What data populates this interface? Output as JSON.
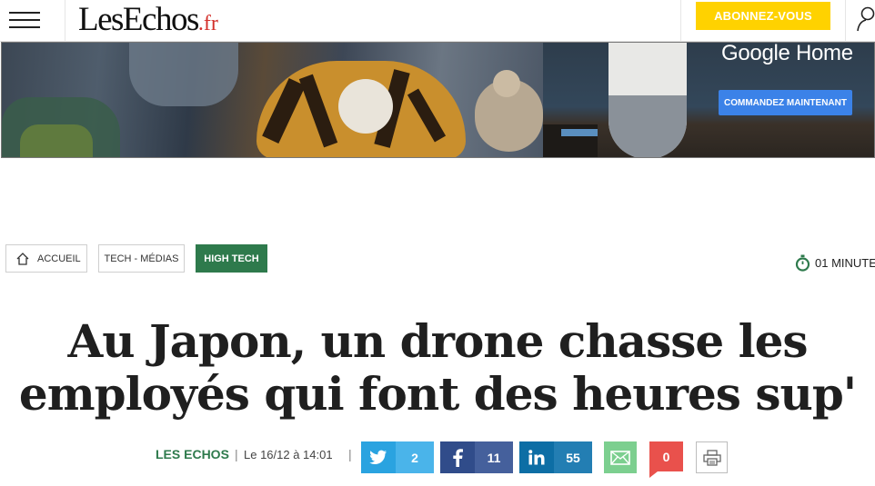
{
  "header": {
    "logo_main": "LesEchos",
    "logo_tld": ".fr",
    "subscribe_label": "ABONNEZ-VOUS"
  },
  "ad": {
    "title": "Google Home",
    "cta_label": "COMMANDEZ MAINTENANT"
  },
  "breadcrumb": {
    "items": [
      {
        "label": "ACCUEIL"
      },
      {
        "label": "TECH - MÉDIAS"
      },
      {
        "label": "HIGH TECH"
      }
    ]
  },
  "reading_time": "01 MINUTE",
  "article": {
    "headline_line1": "Au Japon, un drone chasse les",
    "headline_line2": "employés qui font des heures sup'",
    "source": "LES ECHOS",
    "date": "Le 16/12 à 14:01",
    "separator": "|"
  },
  "share": {
    "twitter_count": "2",
    "facebook_count": "11",
    "linkedin_count": "55",
    "comments_count": "0"
  },
  "colors": {
    "accent_green": "#2e7a4c",
    "subscribe_yellow": "#ffd200",
    "logo_red": "#d3302b",
    "twitter": "#2aa3e0",
    "facebook": "#304c8a",
    "linkedin": "#0d6ea5",
    "mail": "#7ccf8f",
    "comments": "#e9514c"
  },
  "icons": [
    "menu-icon",
    "user-icon",
    "home-icon",
    "stopwatch-icon",
    "twitter-icon",
    "facebook-icon",
    "linkedin-icon",
    "mail-icon",
    "print-icon"
  ]
}
